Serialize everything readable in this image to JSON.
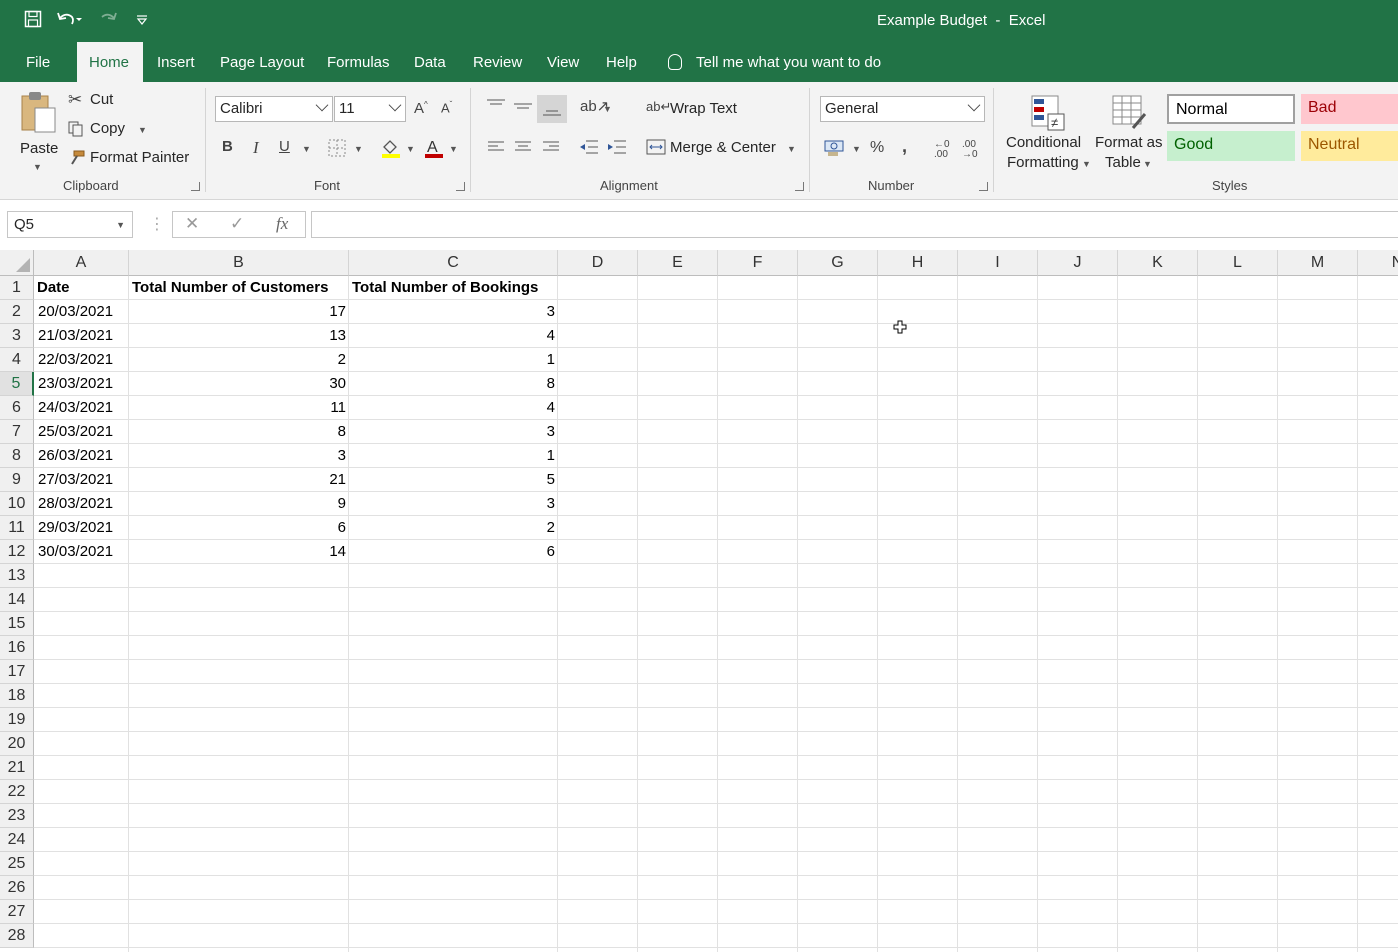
{
  "window": {
    "title": "Example Budget  -  Excel"
  },
  "tabs": [
    {
      "label": "File"
    },
    {
      "label": "Home"
    },
    {
      "label": "Insert"
    },
    {
      "label": "Page Layout"
    },
    {
      "label": "Formulas"
    },
    {
      "label": "Data"
    },
    {
      "label": "Review"
    },
    {
      "label": "View"
    },
    {
      "label": "Help"
    }
  ],
  "tell_me": "Tell me what you want to do",
  "ribbon": {
    "clipboard": {
      "paste": "Paste",
      "cut": "Cut",
      "copy": "Copy",
      "format_painter": "Format Painter",
      "label": "Clipboard"
    },
    "font": {
      "family": "Calibri",
      "size": "11",
      "label": "Font"
    },
    "alignment": {
      "wrap_text": "Wrap Text",
      "merge_center": "Merge & Center",
      "label": "Alignment"
    },
    "number": {
      "format": "General",
      "label": "Number"
    },
    "styles": {
      "conditional_1": "Conditional",
      "conditional_2": "Formatting",
      "format_table_1": "Format as",
      "format_table_2": "Table",
      "normal": "Normal",
      "bad": "Bad",
      "good": "Good",
      "neutral": "Neutral",
      "label": "Styles"
    }
  },
  "formula_bar": {
    "name_box": "Q5",
    "fx": "fx"
  },
  "sheet": {
    "columns": [
      "A",
      "B",
      "C",
      "D",
      "E",
      "F",
      "G",
      "H",
      "I",
      "J",
      "K",
      "L",
      "M",
      "N"
    ],
    "rows": [
      "1",
      "2",
      "3",
      "4",
      "5",
      "6",
      "7",
      "8",
      "9",
      "10",
      "11",
      "12",
      "13",
      "14",
      "15",
      "16",
      "17",
      "18",
      "19",
      "20",
      "21",
      "22",
      "23",
      "24",
      "25",
      "26",
      "27",
      "28"
    ],
    "selected_row": "5",
    "headers": [
      "Date",
      "Total Number of Customers",
      "Total Number of Bookings"
    ],
    "data": [
      [
        "20/03/2021",
        "17",
        "3"
      ],
      [
        "21/03/2021",
        "13",
        "4"
      ],
      [
        "22/03/2021",
        "2",
        "1"
      ],
      [
        "23/03/2021",
        "30",
        "8"
      ],
      [
        "24/03/2021",
        "11",
        "4"
      ],
      [
        "25/03/2021",
        "8",
        "3"
      ],
      [
        "26/03/2021",
        "3",
        "1"
      ],
      [
        "27/03/2021",
        "21",
        "5"
      ],
      [
        "28/03/2021",
        "9",
        "3"
      ],
      [
        "29/03/2021",
        "6",
        "2"
      ],
      [
        "30/03/2021",
        "14",
        "6"
      ]
    ]
  },
  "colors": {
    "accent": "#217346",
    "bad_bg": "#ffc7ce",
    "bad_fg": "#9c0006",
    "good_bg": "#c6efce",
    "good_fg": "#006100",
    "neutral_bg": "#ffeb9c",
    "neutral_fg": "#9c5700"
  }
}
